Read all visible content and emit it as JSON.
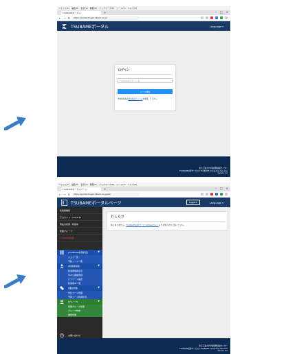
{
  "colors": {
    "header": "#1a3a66",
    "footer": "#0c2a52",
    "arrow": "#3b7dc4",
    "sidebar": "#2a2a2a",
    "sidebar_blue": "#1a4fa8",
    "sidebar_green": "#2e7d32",
    "button": "#1e90ff"
  },
  "browser": {
    "menus": [
      "ファイル(F)",
      "編集(E)",
      "表示(V)",
      "履歴(S)",
      "ブックマーク(B)",
      "ツール(T)",
      "ヘルプ(H)"
    ],
    "tab1_label": "TSUBAMEポータル",
    "tab2_label": "TSUBAMEポータルページ",
    "url1": "https://portal.t3.gsic.titech.ac.jp/",
    "url2": "https://portal.t3.gsic.titech.ac.jp/ptl/"
  },
  "login_page": {
    "site_title": "TSUBAMEポータル",
    "language_label": "Language",
    "card_title": "ログイン",
    "input_placeholder": "TSUBAMEログイン名",
    "button_label": "メール送信",
    "note_prefix": "学外利用者は",
    "note_link": "利用申請フォーム",
    "note_suffix": "を参照して下さい。",
    "footer_line1": "東京工業大学学術国際情報センター",
    "footer_line2": "TSUBAME計算サービス / TSUBAME Computing Services",
    "footer_line3": "Version 3.0"
  },
  "portal_page": {
    "site_title": "TSUBAMEポータルページ",
    "logout_label": "Logout",
    "language_label": "Language",
    "sidebar_rows": [
      {
        "label": "利用者種別",
        "red": false
      },
      {
        "label": "アカウント : xx0-2-24",
        "red": false
      },
      {
        "label": "現在の状態 : 利用中",
        "red": false
      },
      {
        "label": "所属グループ :",
        "red": false
      },
      {
        "label": "TSUBAME利用",
        "red": true
      }
    ],
    "sec1": {
      "title": "[TSUBAME利用状況]",
      "items": [
        "ジョブ一覧",
        "予約ノード一覧"
      ]
    },
    "sec2": {
      "title": "[利用者情報]",
      "items": [
        "利用者情報表示",
        "SSH公開鍵登録",
        "パスワード設定",
        "利用者ID一覧"
      ]
    },
    "sec3": {
      "title": "[課金管理]",
      "items": [
        "支払コード管理",
        "予算コード利用状況"
      ]
    },
    "sec4": {
      "title": "[グループ]",
      "items": [
        "所属グループ管理",
        "グループ作成",
        "課題管理"
      ]
    },
    "bottom_item": "お問い合わせ",
    "notice_title": "おしらせ",
    "notice_prefix": "特にありません。",
    "notice_link": "TSUBAME計算サービスのWebサイト",
    "notice_suffix": "よりお知らせをご覧ください。",
    "footer_line1": "東京工業大学学術国際情報センター",
    "footer_line2": "TSUBAME計算サービス / TSUBAME Computing Services",
    "footer_line3": "Version 4.0"
  }
}
